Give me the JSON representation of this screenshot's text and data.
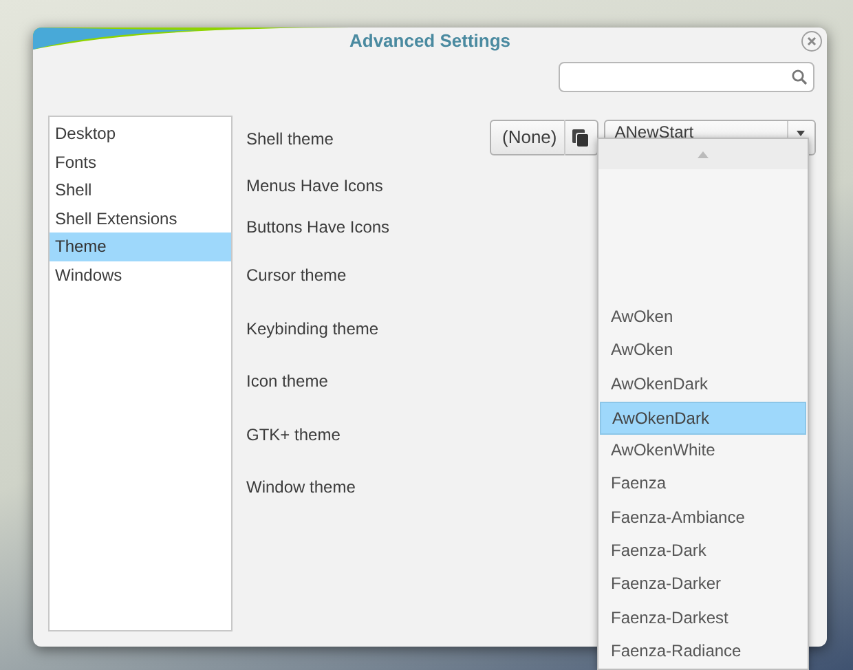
{
  "window": {
    "title": "Advanced Settings"
  },
  "sidebar": {
    "items": [
      {
        "label": "Desktop",
        "selected": false
      },
      {
        "label": "Fonts",
        "selected": false
      },
      {
        "label": "Shell",
        "selected": false
      },
      {
        "label": "Shell Extensions",
        "selected": false
      },
      {
        "label": "Theme",
        "selected": true
      },
      {
        "label": "Windows",
        "selected": false
      }
    ]
  },
  "settings": [
    {
      "label": "Shell theme"
    },
    {
      "label": "Menus Have Icons"
    },
    {
      "label": "Buttons Have Icons"
    },
    {
      "label": "Cursor theme"
    },
    {
      "label": "Keybinding theme"
    },
    {
      "label": "Icon theme"
    },
    {
      "label": "GTK+ theme"
    },
    {
      "label": "Window theme"
    }
  ],
  "shell_theme": {
    "button": "(None)",
    "combo_value": "ANewStart"
  },
  "popup": {
    "items": [
      {
        "label": "AwOken",
        "selected": false
      },
      {
        "label": "AwOken",
        "selected": false
      },
      {
        "label": "AwOkenDark",
        "selected": false
      },
      {
        "label": "AwOkenDark",
        "selected": true
      },
      {
        "label": "AwOkenWhite",
        "selected": false
      },
      {
        "label": "Faenza",
        "selected": false
      },
      {
        "label": "Faenza-Ambiance",
        "selected": false
      },
      {
        "label": "Faenza-Dark",
        "selected": false
      },
      {
        "label": "Faenza-Darker",
        "selected": false
      },
      {
        "label": "Faenza-Darkest",
        "selected": false
      },
      {
        "label": "Faenza-Radiance",
        "selected": false
      }
    ]
  }
}
